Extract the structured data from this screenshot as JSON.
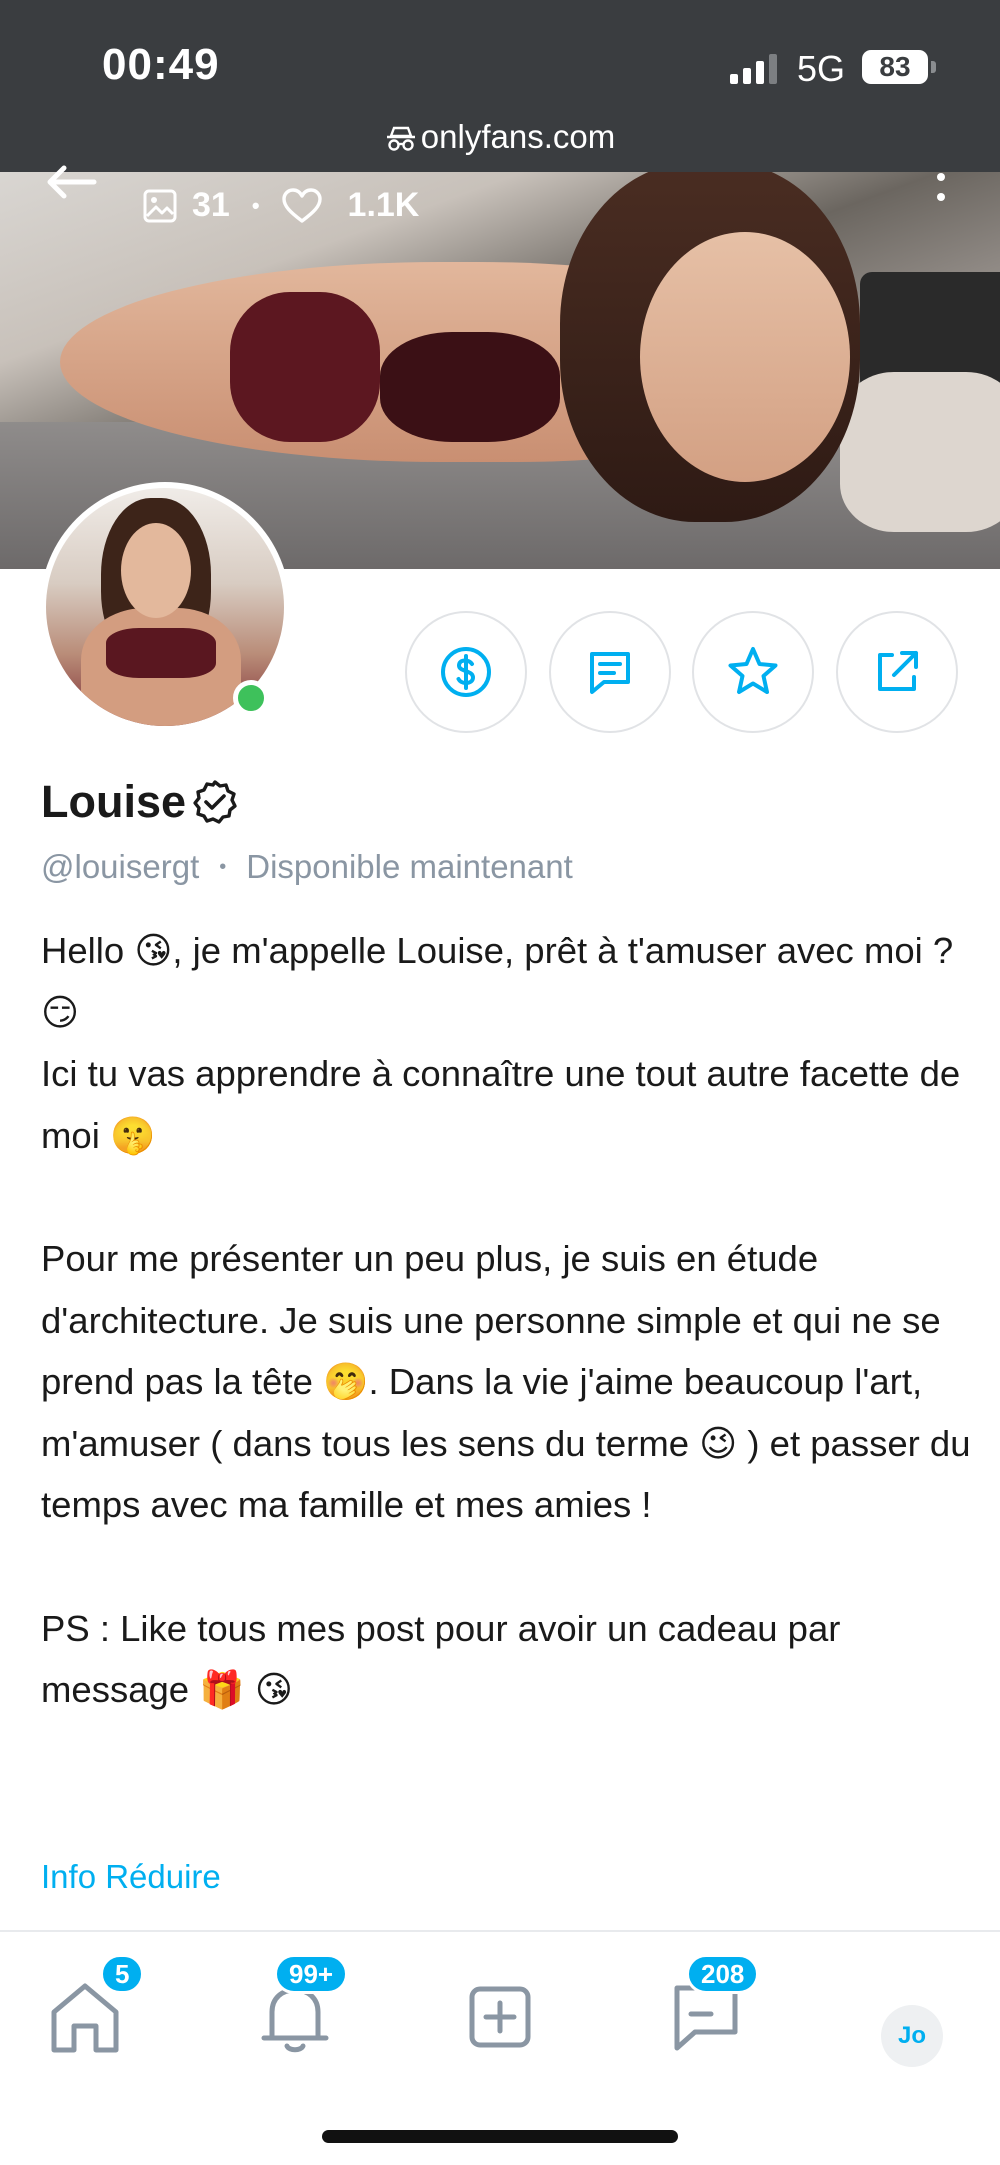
{
  "status_bar": {
    "time": "00:49",
    "network": "5G",
    "battery": "83",
    "url": "onlyfans.com"
  },
  "cover": {
    "media_count": "31",
    "likes_count": "1.1K"
  },
  "profile": {
    "name": "Louise",
    "handle": "@louisergt",
    "availability": "Disponible maintenant",
    "online": true
  },
  "bio": {
    "lines": [
      "Hello 😘, je m'appelle Louise, prêt à t'amuser avec moi ? 😏",
      "Ici tu vas apprendre à connaître une tout autre facette de moi 🤫",
      "",
      "Pour me présenter un peu plus, je suis en étude d'architecture. Je suis une personne simple et qui ne se prend pas la tête 🤭. Dans la vie j'aime beaucoup l'art, m'amuser ( dans tous les sens du terme 😉 ) et passer du temps avec ma famille et mes amies !",
      "",
      "PS : Like tous mes post pour avoir un cadeau par message 🎁 😘"
    ]
  },
  "info_link": "Info Réduire",
  "actions": [
    "tip-icon",
    "message-icon",
    "favorite-icon",
    "share-icon"
  ],
  "tabbar": {
    "home_badge": "5",
    "notifications_badge": "99+",
    "messages_badge": "208",
    "user_initials": "Jo"
  },
  "colors": {
    "accent": "#00aff0",
    "online": "#3ec15b",
    "muted": "#8a96a3",
    "status_bar": "#3a3d40"
  }
}
